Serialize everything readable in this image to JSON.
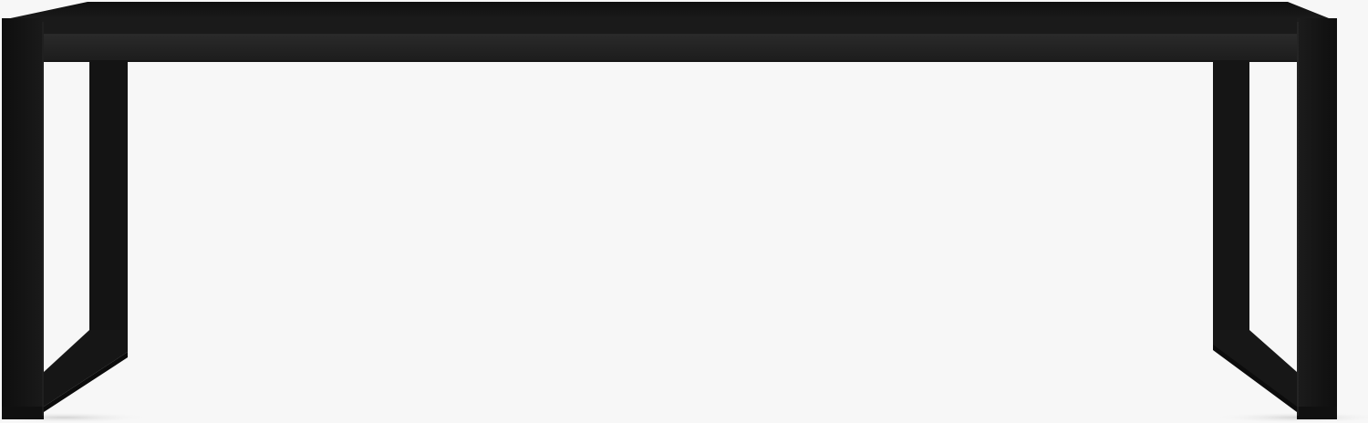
{
  "colors": {
    "background": "#f7f7f7",
    "tabletop_top": "#151515",
    "tabletop_front": "#1f1f1f",
    "apron": "#242424",
    "leg_front": "#121212",
    "leg_side": "#262626",
    "leg_shadow": "#0b0b0b",
    "floor_shadow": "#dcdcdc"
  }
}
